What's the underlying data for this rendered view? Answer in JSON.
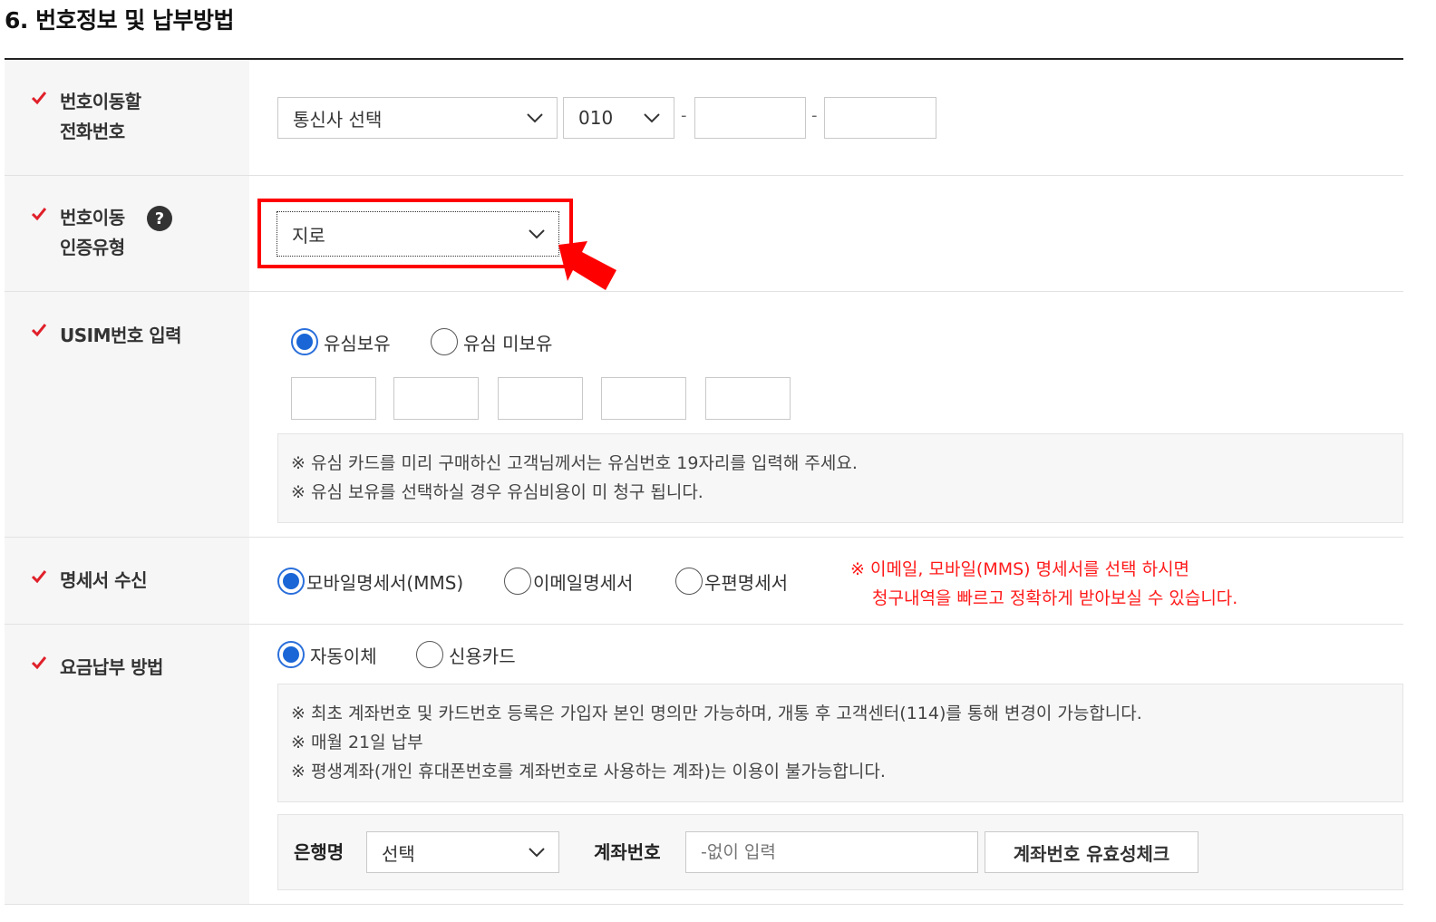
{
  "section_title": "6. 번호정보 및 납부방법",
  "rows": {
    "phone": {
      "label_line1": "번호이동할",
      "label_line2": "전화번호",
      "carrier_select": "통신사 선택",
      "prefix_select": "010",
      "dash": "-"
    },
    "auth": {
      "label_line1": "번호이동",
      "label_line2": "인증유형",
      "help": "?",
      "auth_select": "지로"
    },
    "usim": {
      "label": "USIM번호 입력",
      "radio_have": "유심보유",
      "radio_none": "유심 미보유",
      "notes": [
        "※ 유심 카드를 미리 구매하신 고객님께서는 유심번호 19자리를 입력해 주세요.",
        "※ 유심 보유를 선택하실 경우 유심비용이 미 청구 됩니다."
      ]
    },
    "statement": {
      "label": "명세서 수신",
      "radio_mms": "모바일명세서(MMS)",
      "radio_email": "이메일명세서",
      "radio_post": "우편명세서",
      "note_line1": "※ 이메일, 모바일(MMS) 명세서를 선택 하시면",
      "note_line2": "청구내역을 빠르고 정확하게 받아보실 수 있습니다."
    },
    "payment": {
      "label": "요금납부 방법",
      "radio_auto": "자동이체",
      "radio_card": "신용카드",
      "notes": [
        "※ 최초 계좌번호 및 카드번호 등록은 가입자 본인 명의만 가능하며, 개통 후 고객센터(114)를 통해 변경이 가능합니다.",
        "※ 매월 21일 납부",
        "※ 평생계좌(개인 휴대폰번호를 계좌번호로 사용하는 계좌)는 이용이 불가능합니다."
      ],
      "bank_label": "은행명",
      "bank_select": "선택",
      "account_label": "계좌번호",
      "account_placeholder": "-없이 입력",
      "validate_button": "계좌번호 유효성체크"
    }
  },
  "colors": {
    "check": "#e0202a",
    "highlight_box": "#ff0000",
    "arrow": "#ff0000",
    "radio_on": "#1a66d6",
    "red_note": "#ff1a1a"
  }
}
